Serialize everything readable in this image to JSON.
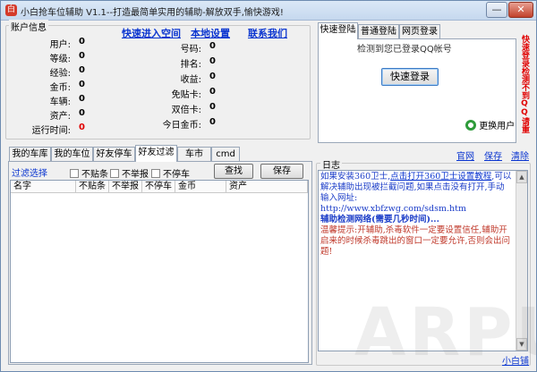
{
  "window": {
    "title": "小白抢车位辅助 V1.1--打造最简单实用的辅助-解放双手,愉快游戏!",
    "minimize_glyph": "—",
    "close_glyph": "✕"
  },
  "account": {
    "group_title": "账户信息",
    "left_fields": [
      {
        "label": "用户:",
        "value": "0"
      },
      {
        "label": "等级:",
        "value": "0"
      },
      {
        "label": "经验:",
        "value": "0"
      },
      {
        "label": "金币:",
        "value": "0"
      },
      {
        "label": "车辆:",
        "value": "0"
      },
      {
        "label": "资产:",
        "value": "0"
      },
      {
        "label": "运行时间:",
        "value": "0"
      }
    ],
    "right_fields": [
      {
        "label": "号码:",
        "value": "0"
      },
      {
        "label": "排名:",
        "value": "0"
      },
      {
        "label": "收益:",
        "value": "0"
      },
      {
        "label": "免贴卡:",
        "value": "0"
      },
      {
        "label": "双倍卡:",
        "value": "0"
      },
      {
        "label": "今日金币:",
        "value": "0"
      }
    ],
    "links": {
      "quick_enter": "快速进入空间",
      "local_settings": "本地设置",
      "contact_us": "联系我们"
    }
  },
  "login": {
    "tabs": [
      "快速登陆",
      "普通登陆",
      "网页登录"
    ],
    "detected_text": "检测到您已登录QQ帐号",
    "quick_login_button": "快速登录",
    "switch_user_label": "更换用户",
    "side_warning": "快速登录检测不到QQ请重"
  },
  "main_tabs": [
    "我的车库",
    "我的车位",
    "好友停车",
    "好友过滤",
    "车市",
    "cmd"
  ],
  "filter": {
    "filter_label": "过滤选择",
    "checkboxes": [
      "不贴条",
      "不举报",
      "不停车"
    ],
    "search_button": "查找",
    "save_button": "保存",
    "columns": [
      "名字",
      "不贴条",
      "不举报",
      "不停车",
      "金币",
      "资产"
    ]
  },
  "log": {
    "links": [
      "官网",
      "保存",
      "清除"
    ],
    "group_title": "日志",
    "lines": [
      {
        "text": "如果安装360卫士,",
        "color": "#1a3cc8",
        "bold": false
      },
      {
        "text": "点击打开360卫士设置教程",
        "color": "#0b36d0",
        "bold": false,
        "underline": true
      },
      {
        "text": ",可以解决辅助出现被拦截问题,如果点击没有打开,手动输入网址:",
        "color": "#1a3cc8",
        "bold": false
      },
      {
        "text": "http://www.xbfzwg.com/sdsm.htm",
        "color": "#1a3cc8",
        "bold": false
      },
      {
        "text": "辅助检测网络(需要几秒时间)...",
        "color": "#1a3cc8",
        "bold": true
      },
      {
        "text": "温馨提示:开辅助,杀毒软件一定要设置信任,辅助开启来的时候杀毒跳出的窗口一定要允许,否则会出问题!",
        "color": "#c0392b",
        "bold": false
      }
    ],
    "footer_link": "小白铺"
  },
  "watermark": "ARPUN",
  "colors": {
    "link_blue": "#0b36d0",
    "value_red": "#e00000",
    "log_blue": "#1a3cc8",
    "log_red": "#c0392b"
  }
}
